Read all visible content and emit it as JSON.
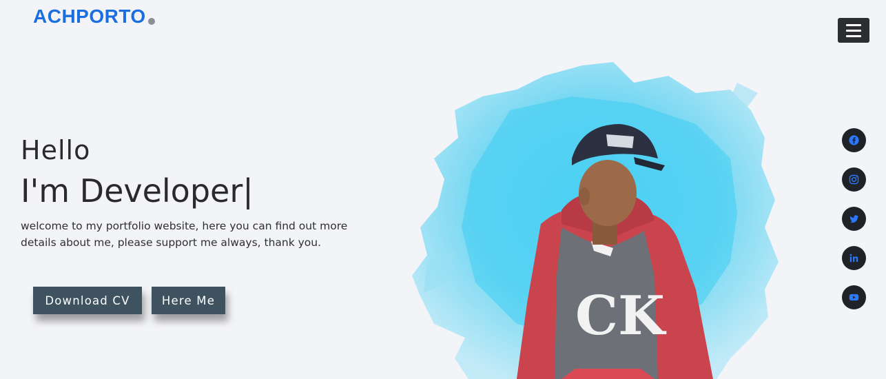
{
  "header": {
    "logo": "ACHPORTO",
    "menu_icon": "hamburger-menu-icon"
  },
  "hero": {
    "greeting": "Hello",
    "role_prefix": "I'm",
    "role": "Developer",
    "cursor": "|",
    "intro_line1": "welcome to my portfolio website, here you can find out more",
    "intro_line2": "details about me, please support me always, thank you.",
    "primary_button": "Download CV",
    "secondary_button": "Here Me"
  },
  "social": [
    {
      "icon": "facebook-icon"
    },
    {
      "icon": "instagram-icon"
    },
    {
      "icon": "twitter-icon"
    },
    {
      "icon": "linkedin-icon"
    },
    {
      "icon": "youtube-icon"
    }
  ],
  "colors": {
    "brand": "#1b6ee0",
    "background": "#f3f4f8",
    "button": "#3e5260",
    "social_bg": "#1f2227",
    "social_icon": "#2b78ff",
    "splash": "#5fd0f3"
  }
}
